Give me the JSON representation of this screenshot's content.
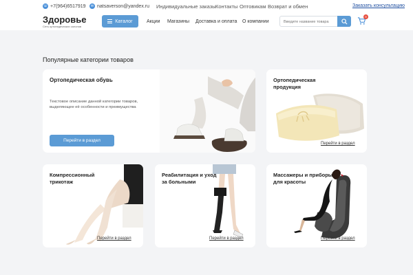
{
  "topbar": {
    "phone": "+7(964)6517919",
    "email": "natsaverson@yandex.ru",
    "links": [
      "Индивидуальные заказы",
      "Контакты",
      "Оптовикам",
      "Возврат и обмен"
    ],
    "consult": "Заказать консультацию"
  },
  "header": {
    "logo_title": "Здоровье",
    "logo_sub": "Сеть ортопедических салонов",
    "catalog": "Каталог",
    "nav": [
      "Акции",
      "Магазины",
      "Доставка и оплата",
      "О компании"
    ],
    "search_placeholder": "Введите название товара",
    "cart_count": "0"
  },
  "section_title": "Популярные категории товаров",
  "cards": {
    "footwear": {
      "title": "Ортопедическая обувь",
      "desc": "Текстовое описание данной категории товаров, выделяющее её особенности и преимущества",
      "button": "Перейти в раздел"
    },
    "ortho": {
      "title1": "Ортопедическая",
      "title2": "продукция",
      "link": "Перейти в раздел"
    },
    "compression": {
      "title1": "Компрессионный",
      "title2": "трикотаж",
      "link": "Перейти в раздел"
    },
    "rehab": {
      "title1": "Реабилитация и уход",
      "title2": "за больными",
      "link": "Перейти в раздел"
    },
    "massage": {
      "title1": "Массажеры и приборы",
      "title2": "для красоты",
      "link": "Перейти в раздел"
    }
  },
  "colors": {
    "accent": "#5b9bd5",
    "background": "#f3f4f6",
    "badge": "#e74c3c"
  }
}
